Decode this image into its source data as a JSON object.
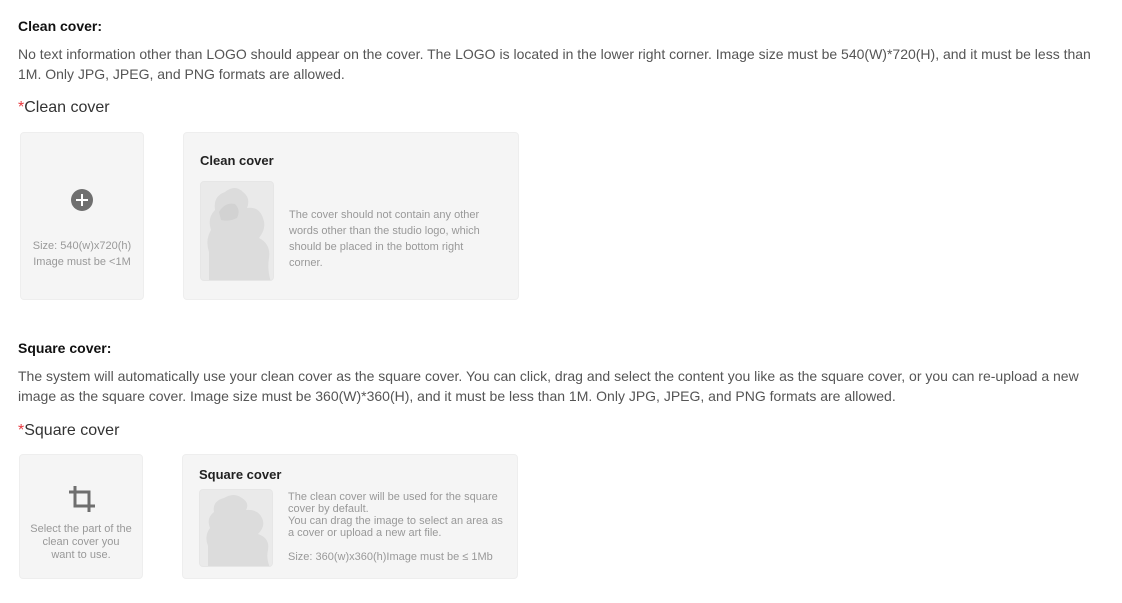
{
  "clean_section": {
    "title": "Clean cover:",
    "description": "No text information other than LOGO should appear on the cover. The LOGO is located in the lower right corner. Image size must be 540(W)*720(H), and it must be less than 1M. Only JPG, JPEG, and PNG formats are allowed.",
    "required_mark": "*",
    "field_label": "Clean cover",
    "upload": {
      "icon": "plus-circle-icon",
      "caption_line1": "Size: 540(w)x720(h)",
      "caption_line2": "Image must be <1M"
    },
    "example": {
      "title": "Clean cover",
      "text": "The cover should not contain any other words other than the studio logo, which should be placed in the bottom right corner."
    }
  },
  "square_section": {
    "title": "Square cover:",
    "description": "The system will automatically use your clean cover as the square cover. You can click, drag and select the content you like as the square cover, or you can re-upload a new image as the square cover. Image size must be 360(W)*360(H), and it must be less than 1M. Only JPG, JPEG, and PNG formats are allowed.",
    "required_mark": "*",
    "field_label": "Square cover",
    "crop": {
      "icon": "crop-icon",
      "caption": "Select the part of the clean cover you want to use."
    },
    "example": {
      "title": "Square cover",
      "text_line1": "The clean cover will be used for the square cover by default.",
      "text_line2": "You can drag the image to select an area as a cover or upload a new art file.",
      "size_note": "Size: 360(w)x360(h)Image must be ≤ 1Mb"
    }
  },
  "colors": {
    "required": "#e8393f",
    "card_bg": "#f5f5f5",
    "hint_text": "#999999"
  }
}
